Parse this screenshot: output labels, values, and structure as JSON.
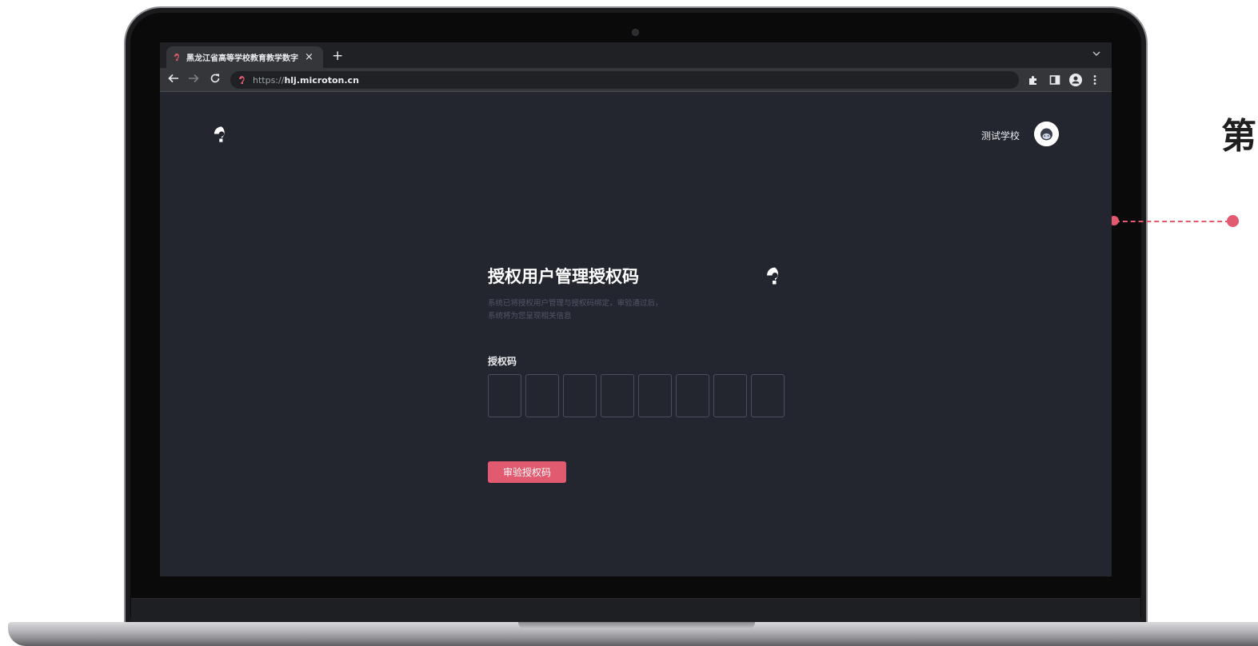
{
  "browser": {
    "tab_title": "黑龙江省高等学校教育教学数字",
    "tab_close": "×",
    "new_tab": "+",
    "url_scheme": "https://",
    "url_host": "hlj.microton.cn"
  },
  "header": {
    "school_name": "测试学校"
  },
  "card": {
    "title": "授权用户管理授权码",
    "description_line1": "系统已将授权用户管理与授权码绑定，审验通过后，",
    "description_line2": "系统将为您呈现相关信息",
    "code_label": "授权码",
    "code_slots": [
      "",
      "",
      "",
      "",
      "",
      "",
      "",
      ""
    ],
    "verify_button": "审验授权码"
  },
  "side": {
    "heading_fragment": "第"
  },
  "colors": {
    "accent": "#e25a6f",
    "page_bg": "#24262f",
    "tab_bg": "#35363a"
  },
  "icons": {
    "logo": "brand-logo-icon",
    "back": "arrow-left-icon",
    "forward": "arrow-right-icon",
    "reload": "reload-icon",
    "extensions": "puzzle-icon",
    "side_panel": "side-panel-icon",
    "profile": "profile-icon",
    "menu": "more-vert-icon"
  }
}
